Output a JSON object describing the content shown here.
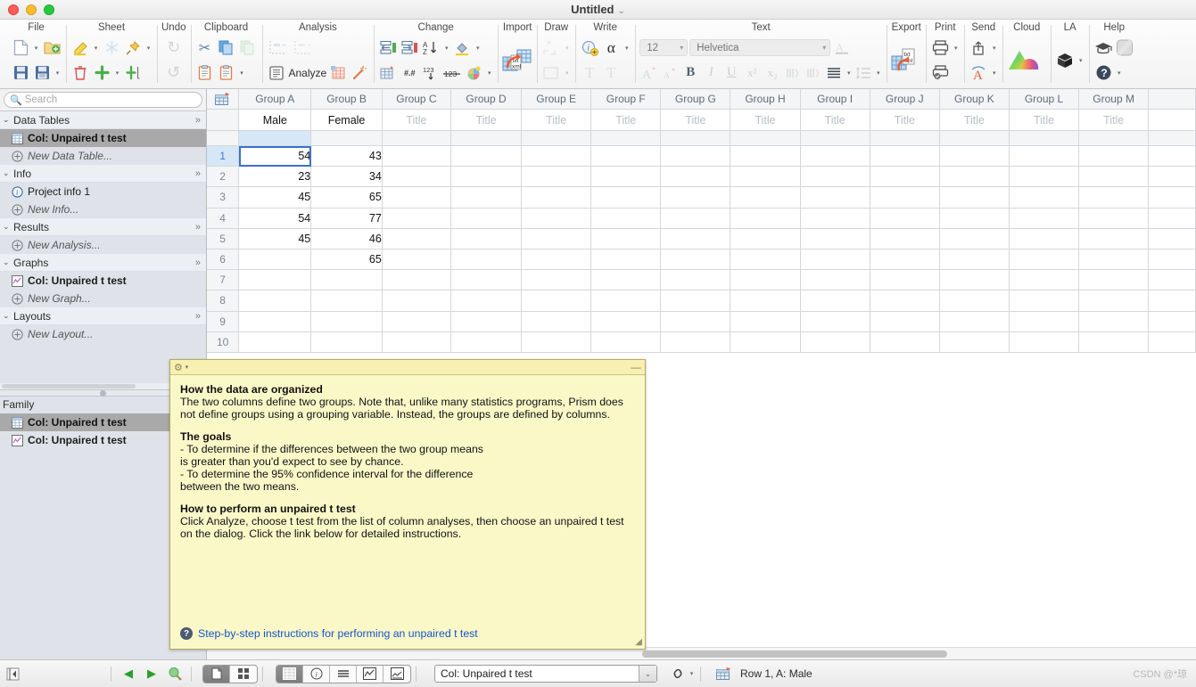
{
  "window": {
    "title": "Untitled",
    "title_chevron": "⌄"
  },
  "ribbon": {
    "groups": [
      {
        "label": "File",
        "row1": [
          {
            "icon": "new-file-icon",
            "glyph": "🗋"
          },
          {
            "icon": "chevron-down-icon",
            "glyph": "▾"
          },
          {
            "icon": "open-folder-icon",
            "glyph": "🗀"
          }
        ],
        "row2": [
          {
            "icon": "save-icon",
            "glyph": "🖫"
          },
          {
            "icon": "save-as-icon",
            "glyph": "🖫"
          },
          {
            "icon": "chevron-down-icon",
            "glyph": "▾"
          }
        ]
      },
      {
        "label": "Sheet",
        "row1": [
          {
            "icon": "highlight-pencil-icon",
            "glyph": "🖉"
          },
          {
            "icon": "chevron-down-icon",
            "glyph": "▾"
          },
          {
            "icon": "freeze-icon",
            "glyph": "❄"
          },
          {
            "icon": "pin-icon",
            "glyph": "📌"
          },
          {
            "icon": "chevron-down-icon",
            "glyph": "▾"
          }
        ],
        "row2": [
          {
            "icon": "delete-trash-icon",
            "glyph": "🗑"
          },
          {
            "icon": "add-plus-icon",
            "glyph": "✚"
          },
          {
            "icon": "chevron-down-icon",
            "glyph": "▾"
          },
          {
            "icon": "add-column-icon",
            "glyph": "⊞"
          }
        ]
      },
      {
        "label": "Undo",
        "row1": [
          {
            "icon": "redo-icon",
            "glyph": "↻"
          }
        ],
        "row2": [
          {
            "icon": "undo-icon",
            "glyph": "↺"
          }
        ]
      },
      {
        "label": "Clipboard",
        "row1": [
          {
            "icon": "cut-scissors-icon",
            "glyph": "✂"
          },
          {
            "icon": "copy-icon",
            "glyph": "⧉"
          },
          {
            "icon": "duplicate-icon",
            "glyph": "❐"
          }
        ],
        "row2": [
          {
            "icon": "paste-icon",
            "glyph": "📋"
          },
          {
            "icon": "paste-special-icon",
            "glyph": "📋"
          },
          {
            "icon": "chevron-down-icon",
            "glyph": "▾"
          }
        ]
      },
      {
        "label": "Analysis",
        "row1": [
          {
            "icon": "analysis-chart-icon",
            "glyph": "⌐"
          },
          {
            "icon": "analysis-chart2-icon",
            "glyph": "⌐"
          }
        ],
        "row2": [
          {
            "icon": "analyze-icon",
            "glyph": "▤",
            "text": "Analyze"
          },
          {
            "icon": "analyze-table-icon",
            "glyph": "▦"
          },
          {
            "icon": "magic-wand-icon",
            "glyph": "✨"
          }
        ]
      },
      {
        "label": "Change",
        "row1": [
          {
            "icon": "insert-left-icon",
            "glyph": "⇤"
          },
          {
            "icon": "insert-right-icon",
            "glyph": "⇥"
          },
          {
            "icon": "sort-az-icon",
            "glyph": "⇣"
          },
          {
            "icon": "chevron-down-icon",
            "glyph": "▾"
          },
          {
            "icon": "fill-color-icon",
            "glyph": "🪣"
          },
          {
            "icon": "chevron-down-icon",
            "glyph": "▾"
          }
        ],
        "row2": [
          {
            "icon": "decimal-icon",
            "glyph": "▦"
          },
          {
            "icon": "decimal-places-icon",
            "glyph": "#.#"
          },
          {
            "icon": "number-format-icon",
            "glyph": "123"
          },
          {
            "icon": "strike-number-icon",
            "glyph": "123"
          },
          {
            "icon": "color-wheel-icon",
            "glyph": "🎨"
          },
          {
            "icon": "chevron-down-icon",
            "glyph": "▾"
          }
        ]
      },
      {
        "label": "Import",
        "row1": [
          {
            "icon": "import-txt-xml-icon",
            "glyph": "▦"
          }
        ]
      },
      {
        "label": "Draw",
        "row1": [
          {
            "icon": "draw-shape-icon",
            "glyph": "⬚"
          },
          {
            "icon": "chevron-down-icon",
            "glyph": "▾"
          }
        ],
        "row2": [
          {
            "icon": "draw-rect-icon",
            "glyph": "▭"
          },
          {
            "icon": "chevron-down-icon",
            "glyph": "▾"
          }
        ]
      },
      {
        "label": "Write",
        "row1": [
          {
            "icon": "info-add-icon",
            "glyph": "ⓘ"
          },
          {
            "icon": "greek-alpha-icon",
            "glyph": "α"
          },
          {
            "icon": "chevron-down-icon",
            "glyph": "▾"
          }
        ],
        "row2": [
          {
            "icon": "text-t-icon",
            "glyph": "T"
          },
          {
            "icon": "text-box-icon",
            "glyph": "T"
          }
        ]
      },
      {
        "label": "Text",
        "font_size": "12",
        "font_family": "Helvetica",
        "row2": [
          {
            "icon": "increase-font-icon",
            "glyph": "A"
          },
          {
            "icon": "decrease-font-icon",
            "glyph": "A"
          },
          {
            "icon": "bold-icon",
            "glyph": "B"
          },
          {
            "icon": "italic-icon",
            "glyph": "I"
          },
          {
            "icon": "underline-icon",
            "glyph": "U"
          },
          {
            "icon": "superscript-icon",
            "glyph": "x²"
          },
          {
            "icon": "subscript-icon",
            "glyph": "x₂"
          },
          {
            "icon": "text-direction-left-icon",
            "glyph": "⫽"
          },
          {
            "icon": "text-direction-right-icon",
            "glyph": "⫽"
          },
          {
            "icon": "align-icon",
            "glyph": "≡"
          },
          {
            "icon": "chevron-down-icon",
            "glyph": "▾"
          },
          {
            "icon": "line-spacing-icon",
            "glyph": "⇕"
          },
          {
            "icon": "chevron-down-icon",
            "glyph": "▾"
          }
        ],
        "font_color_icon": "font-color-icon"
      },
      {
        "label": "Export",
        "row1": [
          {
            "icon": "export-txt-xml-icon",
            "glyph": "▦"
          }
        ]
      },
      {
        "label": "Print",
        "row1": [
          {
            "icon": "print-icon",
            "glyph": "🖨"
          },
          {
            "icon": "chevron-down-icon",
            "glyph": "▾"
          }
        ],
        "row2": [
          {
            "icon": "print-preview-icon",
            "glyph": "🖨"
          }
        ]
      },
      {
        "label": "Send",
        "row1": [
          {
            "icon": "share-icon",
            "glyph": "⇧"
          },
          {
            "icon": "chevron-down-icon",
            "glyph": "▾"
          }
        ],
        "row2": [
          {
            "icon": "send-illustrator-icon",
            "glyph": "A"
          },
          {
            "icon": "chevron-down-icon",
            "glyph": "▾"
          }
        ]
      },
      {
        "label": "Cloud",
        "row1": [
          {
            "icon": "cloud-icon",
            "glyph": "☁"
          }
        ]
      },
      {
        "label": "LA",
        "row1": [
          {
            "icon": "package-cube-icon",
            "glyph": "◆"
          },
          {
            "icon": "chevron-down-icon",
            "glyph": "▾"
          }
        ]
      },
      {
        "label": "Help",
        "row1": [
          {
            "icon": "graduation-cap-icon",
            "glyph": "🎓"
          },
          {
            "icon": "blank-square-icon",
            "glyph": "▢"
          }
        ],
        "row2": [
          {
            "icon": "help-question-icon",
            "glyph": "?"
          },
          {
            "icon": "chevron-down-icon",
            "glyph": "▾"
          }
        ]
      }
    ]
  },
  "sidebar": {
    "search": {
      "placeholder": "Search",
      "value": "",
      "icon": "search-icon"
    },
    "sections": [
      {
        "name": "Data Tables",
        "chevron": "»",
        "twisty": "⌄",
        "items": [
          {
            "label": "Col: Unpaired t test",
            "icon": "data-table-icon",
            "selected": true,
            "ghost": false
          },
          {
            "label": "New Data Table...",
            "icon": "plus-circle-icon",
            "selected": false,
            "ghost": true
          }
        ]
      },
      {
        "name": "Info",
        "chevron": "»",
        "twisty": "⌄",
        "items": [
          {
            "label": "Project info 1",
            "icon": "info-circle-icon",
            "selected": false,
            "ghost": false
          },
          {
            "label": "New Info...",
            "icon": "plus-circle-icon",
            "selected": false,
            "ghost": true
          }
        ]
      },
      {
        "name": "Results",
        "chevron": "»",
        "twisty": "⌄",
        "items": [
          {
            "label": "New Analysis...",
            "icon": "plus-circle-icon",
            "selected": false,
            "ghost": true
          }
        ]
      },
      {
        "name": "Graphs",
        "chevron": "»",
        "twisty": "⌄",
        "items": [
          {
            "label": "Col: Unpaired t test",
            "icon": "graph-icon",
            "selected": false,
            "ghost": false
          },
          {
            "label": "New Graph...",
            "icon": "plus-circle-icon",
            "selected": false,
            "ghost": true
          }
        ]
      },
      {
        "name": "Layouts",
        "chevron": "»",
        "twisty": "⌄",
        "items": [
          {
            "label": "New Layout...",
            "icon": "plus-circle-icon",
            "selected": false,
            "ghost": true
          }
        ]
      }
    ],
    "family": {
      "label": "Family",
      "items": [
        {
          "label": "Col: Unpaired t test",
          "icon": "data-table-icon",
          "selected": true
        },
        {
          "label": "Col: Unpaired t test",
          "icon": "graph-icon",
          "selected": false
        }
      ]
    }
  },
  "sheet": {
    "corner_icon": "data-table-icon",
    "columns": [
      {
        "group": "Group A",
        "title": "Male",
        "placeholder": false
      },
      {
        "group": "Group B",
        "title": "Female",
        "placeholder": false
      },
      {
        "group": "Group C",
        "title": "Title",
        "placeholder": true
      },
      {
        "group": "Group D",
        "title": "Title",
        "placeholder": true
      },
      {
        "group": "Group E",
        "title": "Title",
        "placeholder": true
      },
      {
        "group": "Group F",
        "title": "Title",
        "placeholder": true
      },
      {
        "group": "Group G",
        "title": "Title",
        "placeholder": true
      },
      {
        "group": "Group H",
        "title": "Title",
        "placeholder": true
      },
      {
        "group": "Group I",
        "title": "Title",
        "placeholder": true
      },
      {
        "group": "Group J",
        "title": "Title",
        "placeholder": true
      },
      {
        "group": "Group K",
        "title": "Title",
        "placeholder": true
      },
      {
        "group": "Group L",
        "title": "Title",
        "placeholder": true
      },
      {
        "group": "Group M",
        "title": "Title",
        "placeholder": true
      }
    ],
    "row_numbers": [
      "1",
      "2",
      "3",
      "4",
      "5",
      "6",
      "7",
      "8",
      "9",
      "10"
    ],
    "rows": [
      [
        "54",
        "43",
        "",
        "",
        "",
        "",
        "",
        "",
        "",
        "",
        "",
        "",
        ""
      ],
      [
        "23",
        "34",
        "",
        "",
        "",
        "",
        "",
        "",
        "",
        "",
        "",
        "",
        ""
      ],
      [
        "45",
        "65",
        "",
        "",
        "",
        "",
        "",
        "",
        "",
        "",
        "",
        "",
        ""
      ],
      [
        "54",
        "77",
        "",
        "",
        "",
        "",
        "",
        "",
        "",
        "",
        "",
        "",
        ""
      ],
      [
        "45",
        "46",
        "",
        "",
        "",
        "",
        "",
        "",
        "",
        "",
        "",
        "",
        ""
      ],
      [
        "",
        "65",
        "",
        "",
        "",
        "",
        "",
        "",
        "",
        "",
        "",
        "",
        ""
      ],
      [
        "",
        "",
        "",
        "",
        "",
        "",
        "",
        "",
        "",
        "",
        "",
        "",
        ""
      ],
      [
        "",
        "",
        "",
        "",
        "",
        "",
        "",
        "",
        "",
        "",
        "",
        "",
        ""
      ],
      [
        "",
        "",
        "",
        "",
        "",
        "",
        "",
        "",
        "",
        "",
        "",
        "",
        ""
      ],
      [
        "",
        "",
        "",
        "",
        "",
        "",
        "",
        "",
        "",
        "",
        "",
        "",
        ""
      ]
    ],
    "active_cell": {
      "row": 0,
      "col": 0
    }
  },
  "note": {
    "gear_icon": "gear-icon",
    "caret": "▾",
    "minimize": "—",
    "sections": [
      {
        "heading": "How the data are organized",
        "body": "The two columns define two groups. Note that, unlike many statistics programs, Prism does not define groups using a grouping variable. Instead, the groups are defined by columns."
      },
      {
        "heading": "The goals",
        "body": "- To determine if the differences between the two group means\n   is greater than you'd expect to see by chance.\n- To determine the 95% confidence interval for the difference\n  between the two means."
      },
      {
        "heading": "How to perform an unpaired t test",
        "body": "Click  Analyze, choose t test from the list of column analyses, then choose an unpaired t test on the dialog. Click the link below for detailed instructions."
      }
    ],
    "link": {
      "label": "Step-by-step instructions for performing an unpaired t test",
      "icon": "question-circle-icon"
    },
    "resizer": "◢"
  },
  "statusbar": {
    "first_button": "◀|",
    "prev_button": "◀",
    "next_button": "▶",
    "search_button": "🔍",
    "view_single_icon": "page-view-icon",
    "view_grid_icon": "grid-view-icon",
    "tab_data_icon": "data-table-icon",
    "tab_info_icon": "info-circle-icon",
    "tab_results_icon": "results-icon",
    "tab_graph_icon": "graph-icon",
    "tab_layout_icon": "layout-icon",
    "sheet_selector": {
      "value": "Col: Unpaired t test",
      "arrow": "⌄"
    },
    "link_icon": "chain-link-icon",
    "link_caret": "▾",
    "location_icon": "data-table-icon",
    "location_text": "Row 1, A: Male",
    "watermark": "CSDN @*琼"
  }
}
